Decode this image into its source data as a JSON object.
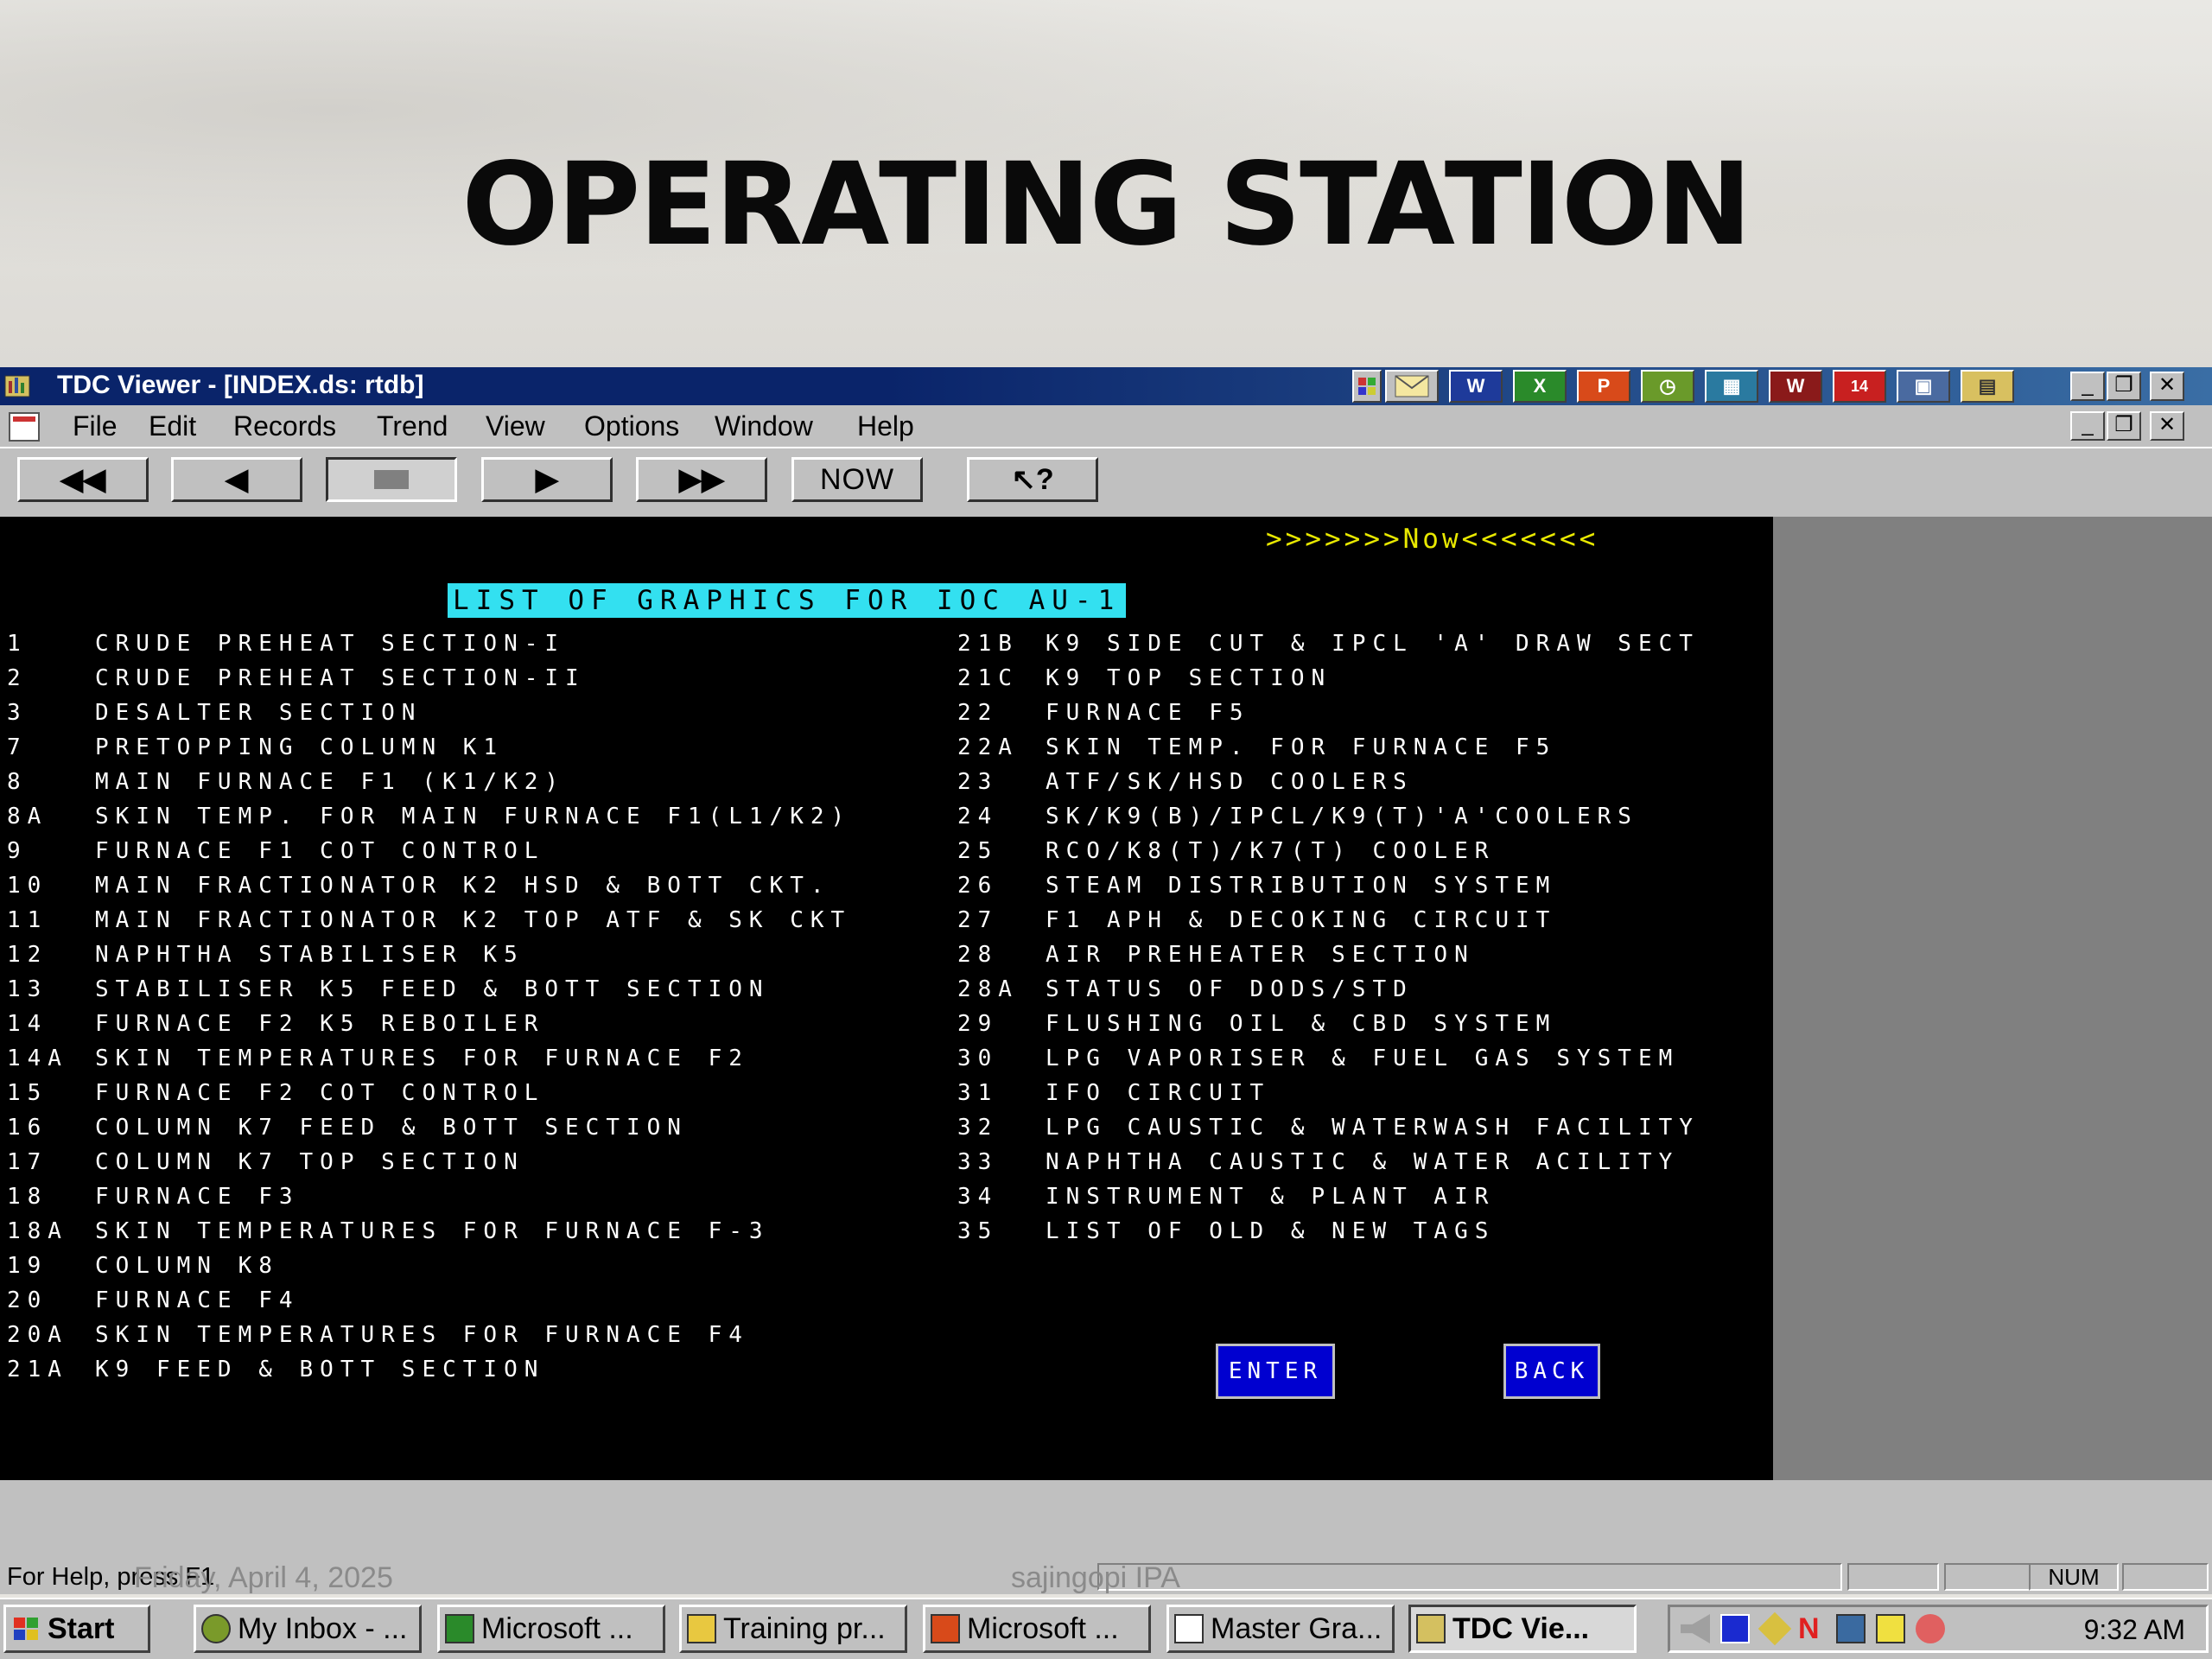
{
  "slide": {
    "title": "OPERATING STATION"
  },
  "window": {
    "title": "TDC Viewer - [INDEX.ds: rtdb]",
    "menu": [
      "File",
      "Edit",
      "Records",
      "Trend",
      "View",
      "Options",
      "Window",
      "Help"
    ],
    "toolbar": {
      "now_label": "NOW",
      "help_label": "?"
    }
  },
  "screen": {
    "now_marker": ">>>>>>>Now<<<<<<<",
    "list_title": "LIST OF GRAPHICS FOR IOC  AU-1",
    "left_items": [
      {
        "num": "1",
        "label": "CRUDE PREHEAT SECTION-I"
      },
      {
        "num": "2",
        "label": "CRUDE PREHEAT SECTION-II"
      },
      {
        "num": "3",
        "label": "DESALTER SECTION"
      },
      {
        "num": "7",
        "label": "PRETOPPING COLUMN K1"
      },
      {
        "num": "8",
        "label": "MAIN FURNACE F1 (K1/K2)"
      },
      {
        "num": "8A",
        "label": "SKIN TEMP. FOR MAIN FURNACE F1(L1/K2)"
      },
      {
        "num": "9",
        "label": "FURNACE F1 COT CONTROL"
      },
      {
        "num": "10",
        "label": "MAIN FRACTIONATOR K2 HSD & BOTT CKT."
      },
      {
        "num": "11",
        "label": "MAIN FRACTIONATOR K2 TOP ATF & SK CKT"
      },
      {
        "num": "12",
        "label": "NAPHTHA STABILISER K5"
      },
      {
        "num": "13",
        "label": "STABILISER K5 FEED & BOTT SECTION"
      },
      {
        "num": "14",
        "label": "FURNACE F2 K5 REBOILER"
      },
      {
        "num": "14A",
        "label": "SKIN TEMPERATURES FOR FURNACE F2"
      },
      {
        "num": "15",
        "label": "FURNACE F2 COT CONTROL"
      },
      {
        "num": "16",
        "label": "COLUMN K7 FEED & BOTT SECTION"
      },
      {
        "num": "17",
        "label": "COLUMN K7 TOP SECTION"
      },
      {
        "num": "18",
        "label": "FURNACE F3"
      },
      {
        "num": "18A",
        "label": "SKIN TEMPERATURES FOR FURNACE F-3"
      },
      {
        "num": "19",
        "label": "COLUMN K8"
      },
      {
        "num": "20",
        "label": "FURNACE F4"
      },
      {
        "num": "20A",
        "label": "SKIN TEMPERATURES FOR FURNACE F4"
      },
      {
        "num": "21A",
        "label": "K9 FEED & BOTT SECTION"
      }
    ],
    "right_items": [
      {
        "num": "21B",
        "label": "K9 SIDE CUT & IPCL 'A' DRAW SECT"
      },
      {
        "num": "21C",
        "label": "K9 TOP SECTION"
      },
      {
        "num": "22",
        "label": "FURNACE F5"
      },
      {
        "num": "22A",
        "label": "SKIN TEMP. FOR FURNACE F5"
      },
      {
        "num": "23",
        "label": "ATF/SK/HSD COOLERS"
      },
      {
        "num": "24",
        "label": "SK/K9(B)/IPCL/K9(T)'A'COOLERS"
      },
      {
        "num": "25",
        "label": "RCO/K8(T)/K7(T) COOLER"
      },
      {
        "num": "26",
        "label": "STEAM DISTRIBUTION SYSTEM"
      },
      {
        "num": "27",
        "label": "F1 APH & DECOKING CIRCUIT"
      },
      {
        "num": "28",
        "label": "AIR PREHEATER SECTION"
      },
      {
        "num": "28A",
        "label": "STATUS OF DODS/STD"
      },
      {
        "num": "29",
        "label": "FLUSHING OIL & CBD SYSTEM"
      },
      {
        "num": "30",
        "label": "LPG  VAPORISER & FUEL GAS SYSTEM"
      },
      {
        "num": "31",
        "label": "IFO CIRCUIT"
      },
      {
        "num": "32",
        "label": "LPG CAUSTIC & WATERWASH FACILITY"
      },
      {
        "num": "33",
        "label": "NAPHTHA CAUSTIC & WATER ACILITY"
      },
      {
        "num": "34",
        "label": "INSTRUMENT & PLANT AIR"
      },
      {
        "num": "35",
        "label": "LIST OF OLD & NEW TAGS"
      }
    ],
    "enter_label": "ENTER",
    "back_label": "BACK"
  },
  "status": {
    "help": "For Help, press F1",
    "num_indicator": "NUM"
  },
  "footer": {
    "date": "Friday, April 4, 2025",
    "author": "sajingopi IPA"
  },
  "taskbar": {
    "start": "Start",
    "tasks": [
      {
        "label": "My Inbox - ...",
        "icon": "outlook-icon"
      },
      {
        "label": "Microsoft ...",
        "icon": "excel-icon"
      },
      {
        "label": "Training pr...",
        "icon": "folder-icon"
      },
      {
        "label": "Microsoft ...",
        "icon": "powerpoint-icon"
      },
      {
        "label": "Master Gra...",
        "icon": "document-icon"
      },
      {
        "label": "TDC Vie...",
        "icon": "tdc-icon"
      }
    ],
    "clock": "9:32 AM"
  },
  "colors": {
    "screen_bg": "#000000",
    "title_highlight": "#33e0f0",
    "now_marker": "#e8e800",
    "command_button": "#0000d0",
    "titlebar": "#0a246a"
  }
}
